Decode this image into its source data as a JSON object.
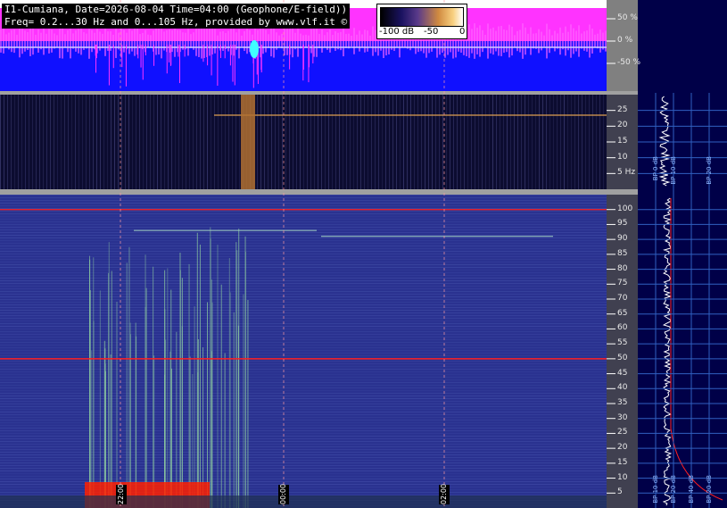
{
  "header": {
    "line1": "I1-Cumiana, Date=2026-08-04 Time=04:00 (Geophone/E-field))",
    "line2": "Freq= 0.2...30 Hz and 0...105 Hz, provided by www.vlf.it ©"
  },
  "colorbar": {
    "labels": [
      "-100 dB",
      "-50",
      "0"
    ]
  },
  "colors": {
    "magenta": "#ff33ff",
    "blue": "#1010ff",
    "dark_bg": "#0a0a2e",
    "spec_bg": "#2a2f8a",
    "line_red": "#ff2020",
    "line_white": "#ffffff",
    "side_bg": "#000040"
  },
  "chart_data": [
    {
      "type": "area",
      "name_panel": "amplitude",
      "ylim": [
        -100,
        100
      ],
      "ytick_labels": [
        "50 %",
        "0 %",
        "-50 %"
      ],
      "yticks": [
        50,
        0,
        -50
      ]
    },
    {
      "type": "heatmap",
      "name_panel": "low-frequency spectrogram",
      "ylim": [
        0,
        30
      ],
      "ytick_labels": [
        "25",
        "20",
        "15",
        "10",
        "5 Hz"
      ],
      "yticks": [
        25,
        20,
        15,
        10,
        5
      ]
    },
    {
      "type": "heatmap",
      "name_panel": "high-frequency spectrogram",
      "ylim": [
        0,
        105
      ],
      "ytick_labels": [
        "100",
        "95",
        "90",
        "85",
        "80",
        "75",
        "70",
        "65",
        "60",
        "55",
        "50",
        "45",
        "40",
        "35",
        "30",
        "25",
        "20",
        "15",
        "10",
        "5"
      ],
      "yticks": [
        100,
        95,
        90,
        85,
        80,
        75,
        70,
        65,
        60,
        55,
        50,
        45,
        40,
        35,
        30,
        25,
        20,
        15,
        10,
        5
      ],
      "xtick_labels": [
        "22:00",
        "00:00",
        "02:00"
      ]
    },
    {
      "type": "line",
      "name_panel": "side spectrum profiles",
      "bp_labels_top": [
        "BP 0 dB",
        "BP 10 dB",
        "BP 20 dB"
      ],
      "bp_labels_bottom": [
        "BP 10 dB",
        "BP 20 dB",
        "BP 40 dB",
        "BP 20 dB"
      ]
    }
  ]
}
